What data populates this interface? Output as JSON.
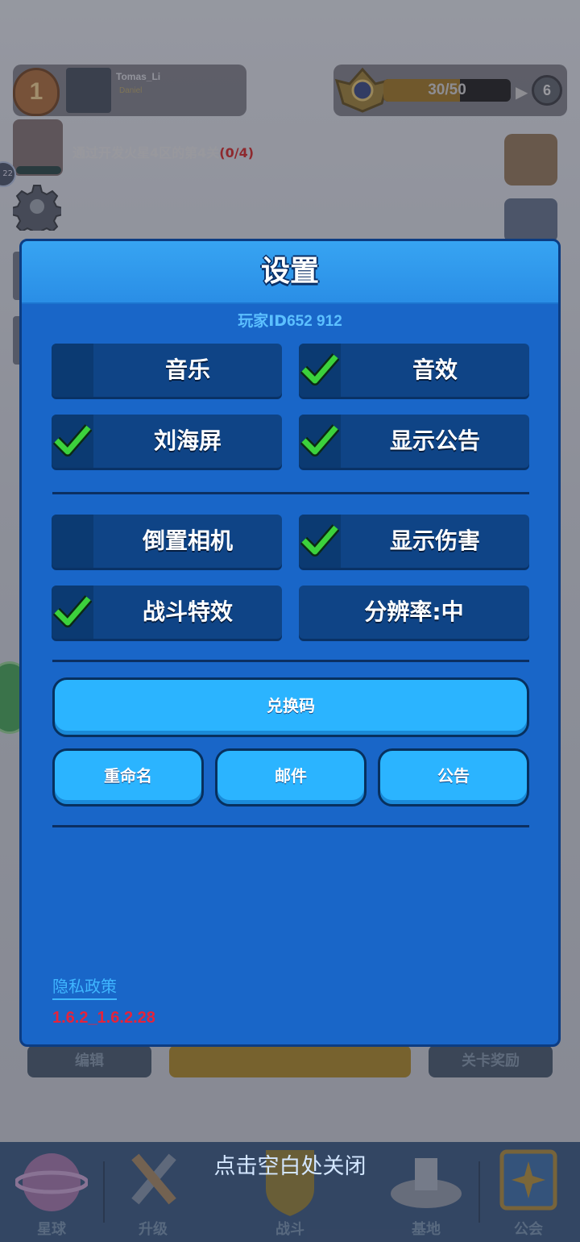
{
  "background": {
    "player": {
      "rank": "1",
      "name": "Tomas_Li",
      "subtitle": "Daniel"
    },
    "xp": {
      "text": "30/50",
      "progress": 0.6,
      "level": "6"
    },
    "mission": {
      "text_main": "通过开发火星4区的第4关",
      "text_progress": "(0/4)",
      "ring_text": "22"
    },
    "under_buttons": {
      "edit": "编辑",
      "rewards": "关卡奖励"
    },
    "nav": {
      "planet": "星球",
      "upgrade": "升级",
      "battle": "战斗",
      "base": "基地",
      "guild": "公会"
    },
    "close_hint": "点击空白处关闭"
  },
  "dialog": {
    "title": "设置",
    "player_id_prefix": "玩家ID",
    "player_id_value": "652 912",
    "options": [
      {
        "label": "音乐",
        "checked": false
      },
      {
        "label": "音效",
        "checked": true
      },
      {
        "label": "刘海屏",
        "checked": true
      },
      {
        "label": "显示公告",
        "checked": true
      },
      {
        "label": "倒置相机",
        "checked": false
      },
      {
        "label": "显示伤害",
        "checked": true
      },
      {
        "label": "战斗特效",
        "checked": true
      },
      {
        "label": "分辨率:中",
        "checked": null
      }
    ],
    "buttons": {
      "redeem": "兑换码",
      "rename": "重命名",
      "mail": "邮件",
      "notice": "公告"
    },
    "privacy": "隐私政策",
    "version": "1.6.2_1.6.2.28"
  },
  "colors": {
    "dialog_bg": "#1966c8",
    "header": "#2a8ee6",
    "check": "#3cd23c",
    "button": "#2bb4ff",
    "version": "#e5233b"
  }
}
